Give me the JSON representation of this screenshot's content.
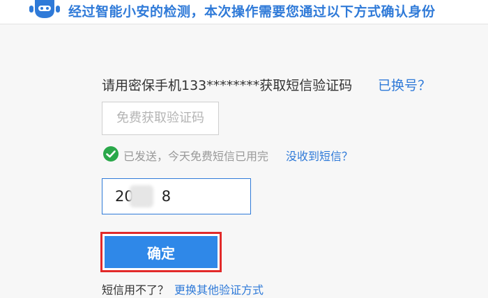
{
  "header": {
    "title": "经过智能小安的检测，本次操作需要您通过以下方式确认身份",
    "mascot_icon": "robot-icon"
  },
  "verify": {
    "prompt": "请用密保手机133********获取短信验证码",
    "change_link": "已换号？",
    "get_code_label": "免费获取验证码",
    "status_icon": "check-circle-icon",
    "status_text": "已发送，今天免费短信已用完",
    "no_sms_link": "没收到短信？",
    "code_value": "20      8",
    "confirm_label": "确定",
    "fallback_text": "短信用不了？",
    "fallback_link": "更换其他验证方式"
  },
  "colors": {
    "accent": "#2f7ad8",
    "button": "#2f88e8",
    "highlight": "#e22a2a",
    "success": "#2aa84a"
  }
}
